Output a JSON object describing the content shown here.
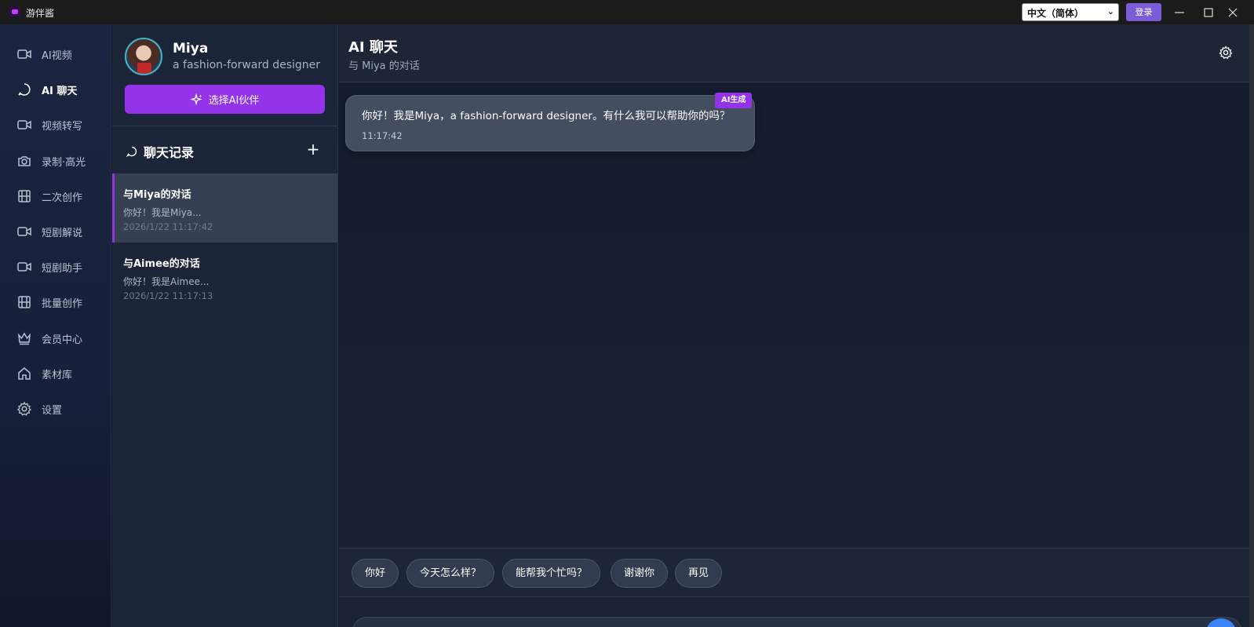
{
  "app": {
    "title": "游伴酱"
  },
  "titlebar": {
    "language": "中文（简体）",
    "login_label": "登录",
    "minimize_symbol": "—",
    "maximize_symbol": "☐",
    "close_symbol": "✕"
  },
  "nav": {
    "items": [
      {
        "label": "AI视频",
        "icon": "video-camera-icon"
      },
      {
        "label": "AI 聊天",
        "icon": "chat-bubble-icon",
        "active": true
      },
      {
        "label": "视频转写",
        "icon": "video-camera-icon"
      },
      {
        "label": "录制·高光",
        "icon": "camera-icon"
      },
      {
        "label": "二次创作",
        "icon": "film-icon"
      },
      {
        "label": "短剧解说",
        "icon": "video-camera-icon"
      },
      {
        "label": "短剧助手",
        "icon": "video-camera-icon"
      },
      {
        "label": "批量创作",
        "icon": "film-icon"
      },
      {
        "label": "会员中心",
        "icon": "crown-icon"
      },
      {
        "label": "素材库",
        "icon": "home-icon"
      },
      {
        "label": "设置",
        "icon": "gear-icon"
      }
    ]
  },
  "agent": {
    "name": "Miya",
    "description": "a fashion-forward designer",
    "choose_label": "选择AI伙伴"
  },
  "history": {
    "title": "聊天记录",
    "add_symbol": "+",
    "conversations": [
      {
        "title": "与Miya的对话",
        "preview": "你好！我是Miya...",
        "date": "2026/1/22 11:17:42",
        "active": true
      },
      {
        "title": "与Aimee的对话",
        "preview": "你好！我是Aimee...",
        "date": "2026/1/22 11:17:13",
        "active": false
      }
    ]
  },
  "main": {
    "title": "AI 聊天",
    "subtitle": "与 Miya 的对话",
    "messages": [
      {
        "text": "你好！我是Miya，a fashion-forward designer。有什么我可以帮助你的吗？",
        "time": "11:17:42",
        "badge": "AI生成"
      }
    ],
    "quick_replies": [
      "你好",
      "今天怎么样？",
      "能帮我个忙吗？",
      "谢谢你",
      "再见"
    ]
  },
  "colors": {
    "accent": "#9333ea",
    "login": "#7a5cd6",
    "send": "#3b82f6"
  }
}
